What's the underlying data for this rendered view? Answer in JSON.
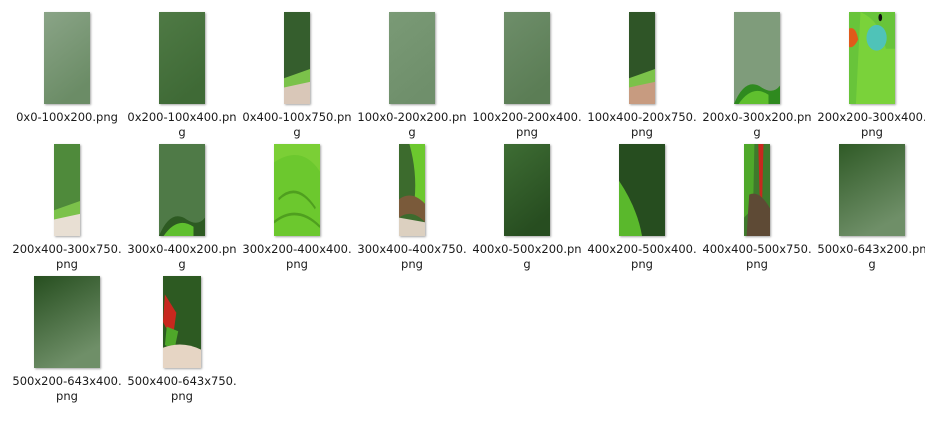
{
  "files": [
    {
      "name": "0x0-100x200.png",
      "thumb": "plain",
      "color_top": "#8aa487",
      "color_bottom": "#6b8c66"
    },
    {
      "name": "0x200-100x400.png",
      "thumb": "plain",
      "color_top": "#4f7a45",
      "color_bottom": "#3f6a36"
    },
    {
      "name": "0x400-100x750.png",
      "thumb": "perch",
      "color_top": "#355e2d",
      "color_bottom": "#d9c7b8"
    },
    {
      "name": "100x0-200x200.png",
      "thumb": "plain",
      "color_top": "#7a9a76",
      "color_bottom": "#6f8f6b"
    },
    {
      "name": "100x200-200x400.png",
      "thumb": "plain",
      "color_top": "#6e8e6a",
      "color_bottom": "#5b7d55"
    },
    {
      "name": "100x400-200x750.png",
      "thumb": "perch",
      "color_top": "#2f5527",
      "color_bottom": "#c79b80"
    },
    {
      "name": "200x0-300x200.png",
      "thumb": "leaf-bottom",
      "color_top": "#7f9c7b",
      "color_bottom": "#2f8a1f"
    },
    {
      "name": "200x200-300x400.png",
      "thumb": "parrot-head",
      "color_top": "#68c43a",
      "color_bottom": "#4ea62a"
    },
    {
      "name": "200x400-300x750.png",
      "thumb": "perch",
      "color_top": "#4f8a3b",
      "color_bottom": "#e8dfd3"
    },
    {
      "name": "300x0-400x200.png",
      "thumb": "leaf-bottom",
      "color_top": "#4f7a47",
      "color_bottom": "#2d5a22"
    },
    {
      "name": "300x200-400x400.png",
      "thumb": "feathers",
      "color_top": "#7bcf36",
      "color_bottom": "#4f9f1f"
    },
    {
      "name": "300x400-400x750.png",
      "thumb": "branch",
      "color_top": "#3c6b2d",
      "color_bottom": "#7a5a3a"
    },
    {
      "name": "400x0-500x200.png",
      "thumb": "plain",
      "color_top": "#3e6d34",
      "color_bottom": "#274d20"
    },
    {
      "name": "400x200-500x400.png",
      "thumb": "leaf-side",
      "color_top": "#264d1f",
      "color_bottom": "#3e7a2e"
    },
    {
      "name": "400x400-500x750.png",
      "thumb": "tail",
      "color_top": "#3f7a2c",
      "color_bottom": "#5e4a35"
    },
    {
      "name": "500x0-643x200.png",
      "thumb": "plain",
      "color_top": "#2f5a26",
      "color_bottom": "#6f8f68"
    },
    {
      "name": "500x200-643x400.png",
      "thumb": "plain",
      "color_top": "#264e1f",
      "color_bottom": "#6f8f68"
    },
    {
      "name": "500x400-643x750.png",
      "thumb": "tail-red",
      "color_top": "#2d5a22",
      "color_bottom": "#e6d5c4"
    }
  ]
}
